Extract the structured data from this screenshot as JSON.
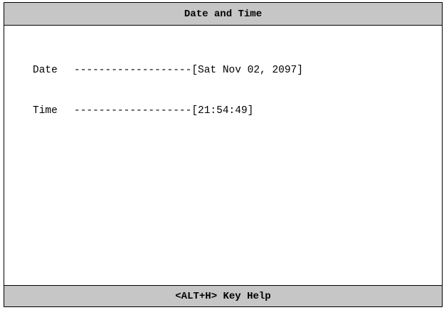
{
  "header": {
    "title": "Date and Time"
  },
  "fields": [
    {
      "label": "Date",
      "leader": "-------------------",
      "value": "[Sat Nov 02, 2097]"
    },
    {
      "label": "Time",
      "leader": "-------------------",
      "value": "[21:54:49]"
    }
  ],
  "footer": {
    "help": "<ALT+H> Key Help"
  },
  "colors": {
    "bar_background": "#c6c6c6",
    "background": "#ffffff",
    "text": "#000000"
  }
}
